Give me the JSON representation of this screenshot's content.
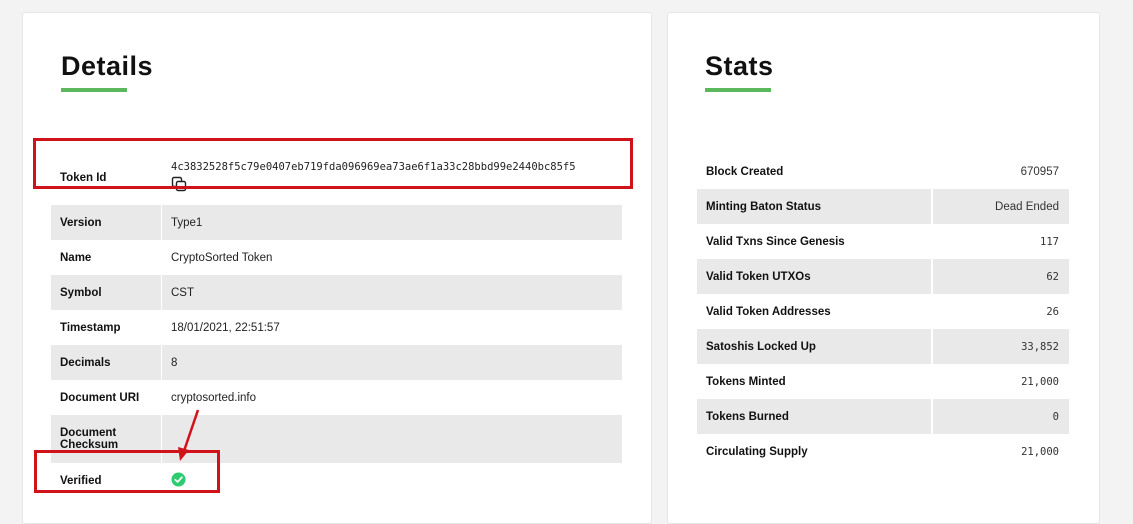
{
  "details": {
    "title": "Details",
    "rows": [
      {
        "key": "Token Id",
        "value": "4c3832528f5c79e0407eb719fda096969ea73ae6f1a33c28bbd99e2440bc85f5"
      },
      {
        "key": "Version",
        "value": "Type1"
      },
      {
        "key": "Name",
        "value": "CryptoSorted Token"
      },
      {
        "key": "Symbol",
        "value": "CST"
      },
      {
        "key": "Timestamp",
        "value": "18/01/2021, 22:51:57"
      },
      {
        "key": "Decimals",
        "value": "8"
      },
      {
        "key": "Document URI",
        "value": "cryptosorted.info"
      },
      {
        "key": "Document Checksum",
        "value": ""
      },
      {
        "key": "Verified",
        "value": "check-circle-icon"
      }
    ]
  },
  "stats": {
    "title": "Stats",
    "rows": [
      {
        "key": "Block Created",
        "value": "670957"
      },
      {
        "key": "Minting Baton Status",
        "value": "Dead Ended"
      },
      {
        "key": "Valid Txns Since Genesis",
        "value": "117"
      },
      {
        "key": "Valid Token UTXOs",
        "value": "62"
      },
      {
        "key": "Valid Token Addresses",
        "value": "26"
      },
      {
        "key": "Satoshis Locked Up",
        "value": "33,852"
      },
      {
        "key": "Tokens Minted",
        "value": "21,000"
      },
      {
        "key": "Tokens Burned",
        "value": "0"
      },
      {
        "key": "Circulating Supply",
        "value": "21,000"
      }
    ]
  },
  "colors": {
    "accent": "#5cb85c",
    "highlight": "#d0121b",
    "verified": "#2ecc71",
    "stripe": "#e9e9e9"
  }
}
